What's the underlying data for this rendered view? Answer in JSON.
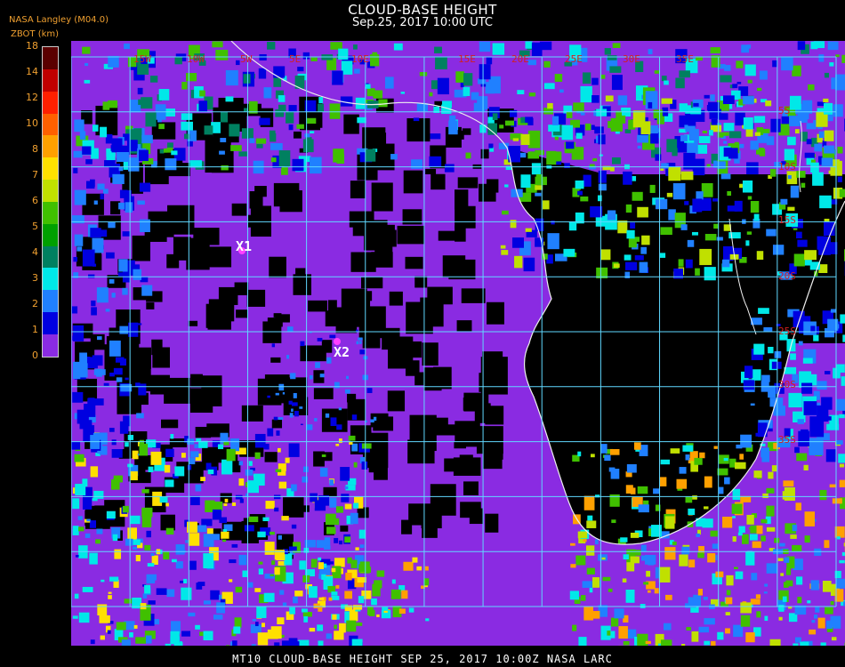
{
  "header": {
    "title": "CLOUD-BASE HEIGHT",
    "subtitle": "Sep.25, 2017 10:00 UTC",
    "source": "NASA Langley (M04.0)",
    "unit": "ZBOT (km)"
  },
  "colorbar": {
    "ticks": [
      "18",
      "14",
      "12",
      "10",
      "8",
      "7",
      "6",
      "5",
      "4",
      "3",
      "2",
      "1",
      "0"
    ],
    "colors": [
      "#5a0000",
      "#c00000",
      "#ff2000",
      "#ff6000",
      "#ffa000",
      "#ffe000",
      "#c0e000",
      "#40c000",
      "#00a000",
      "#008060",
      "#00e8e8",
      "#2080ff",
      "#0000e0",
      "#8a2be2"
    ]
  },
  "map": {
    "lon_labels": [
      "15W",
      "10W",
      "5W",
      "5E",
      "10E",
      "15E",
      "20E",
      "25E",
      "30E",
      "35E"
    ],
    "lat_labels": [
      "5S",
      "10S",
      "15S",
      "20S",
      "25S",
      "30S",
      "35S"
    ],
    "markers": [
      {
        "label": "X1"
      },
      {
        "label": "X2"
      }
    ]
  },
  "footer": "MT10  CLOUD-BASE HEIGHT   SEP 25, 2017 10:00Z   NASA LARC"
}
